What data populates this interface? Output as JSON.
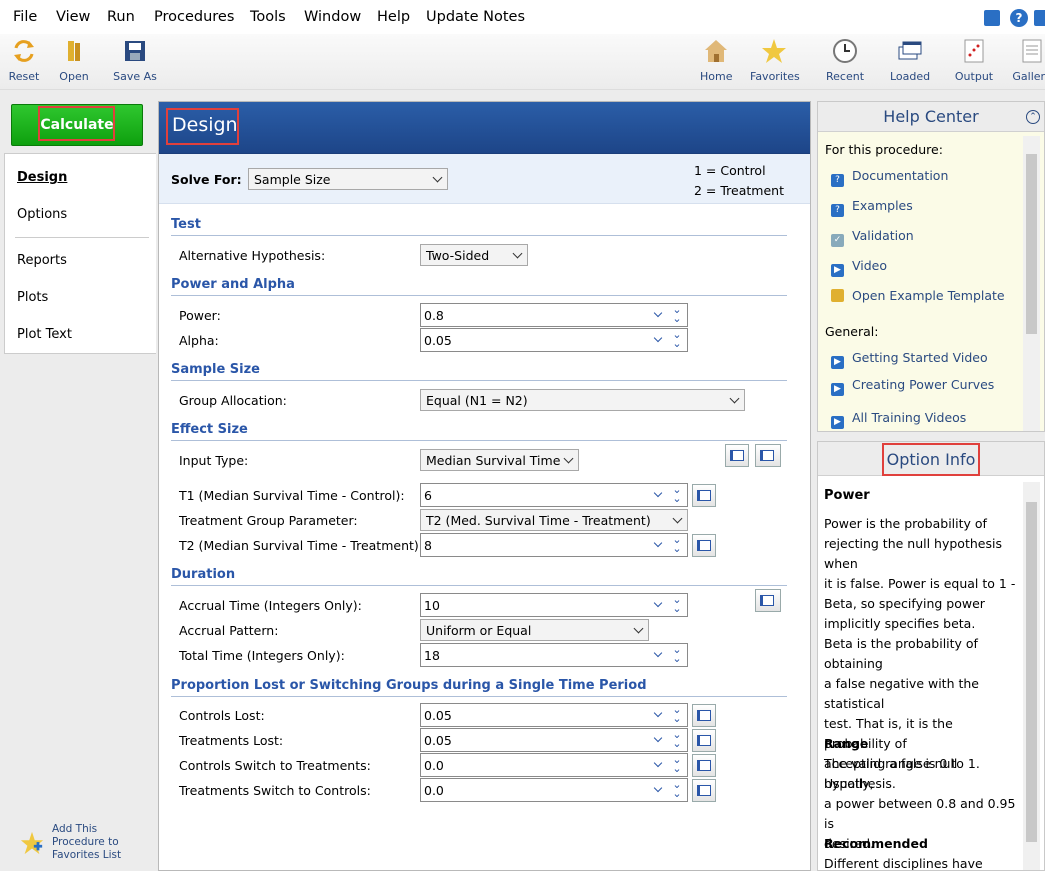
{
  "menu": [
    "File",
    "View",
    "Run",
    "Procedures",
    "Tools",
    "Window",
    "Help",
    "Update Notes"
  ],
  "toolbar": {
    "reset": "Reset",
    "open": "Open",
    "save_as": "Save As",
    "home": "Home",
    "favorites": "Favorites",
    "recent": "Recent",
    "loaded": "Loaded",
    "output": "Output",
    "gallery": "Gallery"
  },
  "calculate": "Calculate",
  "nav": [
    "Design",
    "Options",
    "Reports",
    "Plots",
    "Plot Text"
  ],
  "add_fav": [
    "Add This",
    "Procedure to",
    "Favorites List"
  ],
  "design": {
    "title": "Design",
    "solve_for_label": "Solve For:",
    "solve_for_value": "Sample Size",
    "legend1": "1 = Control",
    "legend2": "2 = Treatment",
    "sections": {
      "test": "Test",
      "power_alpha": "Power and Alpha",
      "sample_size": "Sample Size",
      "effect_size": "Effect Size",
      "duration": "Duration",
      "lost": "Proportion Lost or Switching Groups during a Single Time Period"
    },
    "alt_hyp_label": "Alternative Hypothesis:",
    "alt_hyp_value": "Two-Sided",
    "power_label": "Power:",
    "power_value": "0.8",
    "alpha_label": "Alpha:",
    "alpha_value": "0.05",
    "group_alloc_label": "Group Allocation:",
    "group_alloc_value": "Equal (N1 = N2)",
    "input_type_label": "Input Type:",
    "input_type_value": "Median Survival Time",
    "t1_label": "T1 (Median Survival Time - Control):",
    "t1_value": "6",
    "tgp_label": "Treatment Group Parameter:",
    "tgp_value": "T2 (Med. Survival Time - Treatment)",
    "t2_label": "T2 (Median Survival Time - Treatment):",
    "t2_value": "8",
    "accrual_time_label": "Accrual Time (Integers Only):",
    "accrual_time_value": "10",
    "accrual_pattern_label": "Accrual Pattern:",
    "accrual_pattern_value": "Uniform or Equal",
    "total_time_label": "Total Time (Integers Only):",
    "total_time_value": "18",
    "controls_lost_label": "Controls Lost:",
    "controls_lost_value": "0.05",
    "treatments_lost_label": "Treatments Lost:",
    "treatments_lost_value": "0.05",
    "c2t_label": "Controls Switch to Treatments:",
    "c2t_value": "0.0",
    "t2c_label": "Treatments Switch to Controls:",
    "t2c_value": "0.0"
  },
  "help": {
    "title": "Help Center",
    "for_proc": "For this procedure:",
    "links": [
      "Documentation",
      "Examples",
      "Validation",
      "Video",
      "Open Example Template"
    ],
    "general": "General:",
    "general_links": [
      "Getting Started Video",
      "Creating Power Curves",
      "All Training Videos"
    ]
  },
  "option_info": {
    "title": "Option Info",
    "heading1": "Power",
    "p1": [
      "Power is the probability of",
      "rejecting the null hypothesis when",
      "it is false. Power is equal to 1 -",
      "Beta, so specifying power",
      "implicitly specifies beta."
    ],
    "p2": [
      "Beta is the probability of obtaining",
      "a false negative with the statistical",
      "test. That is, it is the probability of",
      "accepting a false null hypothesis."
    ],
    "heading2": "Range",
    "p3": [
      "The valid range is 0 to 1. Usually,",
      "a power between 0.8 and 0.95 is",
      "desired."
    ],
    "heading3": "Recommended",
    "p4": "Different disciplines have different"
  }
}
